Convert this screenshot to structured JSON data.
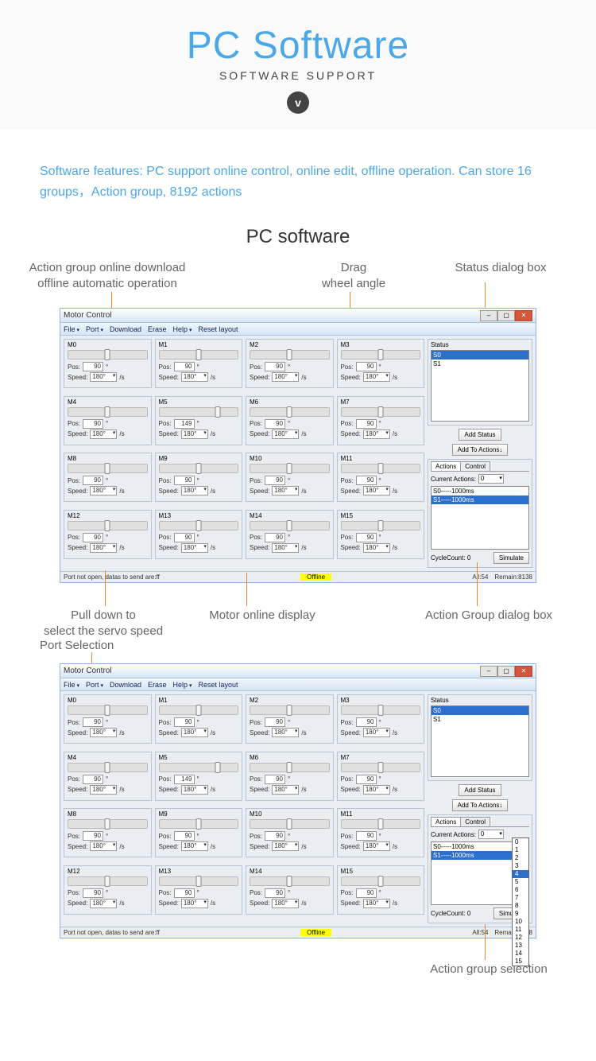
{
  "hero": {
    "title": "PC Software",
    "sub": "SOFTWARE  SUPPORT",
    "badge": "v"
  },
  "features": "Software features: PC support online control, online edit, offline operation. Can store 16 groups，Action group, 8192 actions",
  "section1_title": "PC software",
  "ann": {
    "download": "Action group online download\noffline automatic operation",
    "drag": "Drag\nwheel angle",
    "status": "Status dialog box",
    "speed": "Pull down to\nselect the servo speed",
    "offline": "Motor online display",
    "actions": "Action Group dialog box",
    "port": "Port Selection",
    "groupsel": "Action group selection"
  },
  "win": {
    "title": "Motor Control",
    "menu": [
      "File",
      "Port",
      "Download",
      "Erase",
      "Help",
      "Reset layout"
    ],
    "menu_drop": [
      true,
      true,
      false,
      false,
      true,
      false
    ],
    "motors": [
      {
        "name": "M0",
        "pos": "90",
        "speed": "180°"
      },
      {
        "name": "M1",
        "pos": "90",
        "speed": "180°"
      },
      {
        "name": "M2",
        "pos": "90",
        "speed": "180°"
      },
      {
        "name": "M3",
        "pos": "90",
        "speed": "180°"
      },
      {
        "name": "M4",
        "pos": "90",
        "speed": "180°"
      },
      {
        "name": "M5",
        "pos": "149",
        "speed": "180°"
      },
      {
        "name": "M6",
        "pos": "90",
        "speed": "180°"
      },
      {
        "name": "M7",
        "pos": "90",
        "speed": "180°"
      },
      {
        "name": "M8",
        "pos": "90",
        "speed": "180°"
      },
      {
        "name": "M9",
        "pos": "90",
        "speed": "180°"
      },
      {
        "name": "M10",
        "pos": "90",
        "speed": "180°"
      },
      {
        "name": "M11",
        "pos": "90",
        "speed": "180°"
      },
      {
        "name": "M12",
        "pos": "90",
        "speed": "180°"
      },
      {
        "name": "M13",
        "pos": "90",
        "speed": "180°"
      },
      {
        "name": "M14",
        "pos": "90",
        "speed": "180°"
      },
      {
        "name": "M15",
        "pos": "90",
        "speed": "180°"
      }
    ],
    "pos_label": "Pos:",
    "pos_unit": "°",
    "speed_label": "Speed:",
    "speed_unit": "/s",
    "status_label": "Status",
    "status_items": [
      "S0",
      "S1"
    ],
    "btn_add_status": "Add Status",
    "btn_add_actions": "Add To Actions↓",
    "tab_actions": "Actions",
    "tab_control": "Control",
    "current_actions_label": "Current Actions:",
    "current_actions_val": "0",
    "action_items": [
      "S0-----1000ms",
      "S1-----1000ms"
    ],
    "cycle_label": "CycleCount:",
    "cycle_val": "0",
    "btn_simulate": "Simulate",
    "status_port": "Port not open, datas to send are:ff",
    "status_offline": "Offline",
    "status_all": "All:54",
    "status_remain": "Remain:8138"
  },
  "dropdown_options": [
    "0",
    "1",
    "2",
    "3",
    "4",
    "5",
    "6",
    "7",
    "8",
    "9",
    "10",
    "11",
    "12",
    "13",
    "14",
    "15"
  ]
}
